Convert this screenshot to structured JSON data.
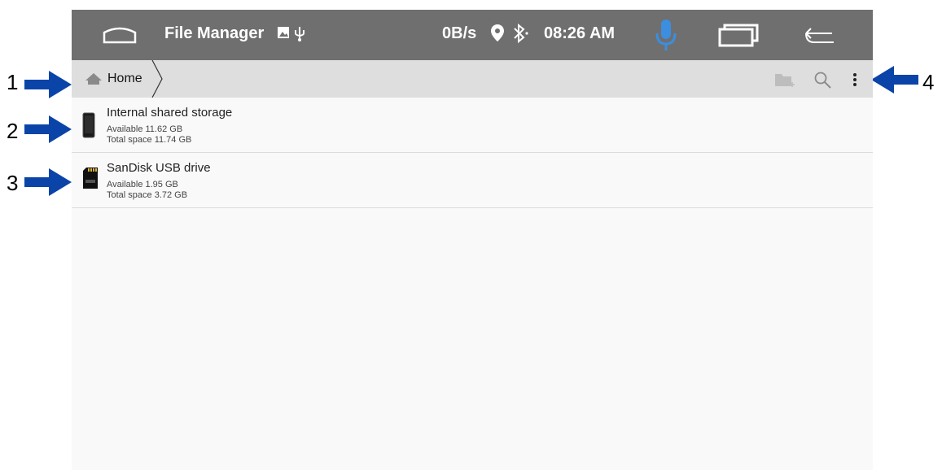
{
  "statusbar": {
    "app_title": "File Manager",
    "net_speed": "0B/s",
    "time": "08:26 AM",
    "mic_color": "#3b8ee0",
    "bar_color": "#6f6f6f"
  },
  "breadcrumb": {
    "home_label": "Home",
    "icons": [
      "home-icon",
      "chevron-right-icon"
    ]
  },
  "toolbar": {
    "icons": [
      "new-folder-icon",
      "search-icon",
      "overflow-menu-icon"
    ]
  },
  "storage": [
    {
      "name": "Internal shared storage",
      "available": "Available 11.62 GB",
      "total": "Total space 11.74 GB",
      "icon": "phone-storage-icon"
    },
    {
      "name": "SanDisk USB drive",
      "available": "Available 1.95 GB",
      "total": "Total space 3.72 GB",
      "icon": "sd-card-icon"
    }
  ],
  "callouts": {
    "one": "1",
    "two": "2",
    "three": "3",
    "four": "4",
    "arrow_color": "#0a44a8"
  }
}
